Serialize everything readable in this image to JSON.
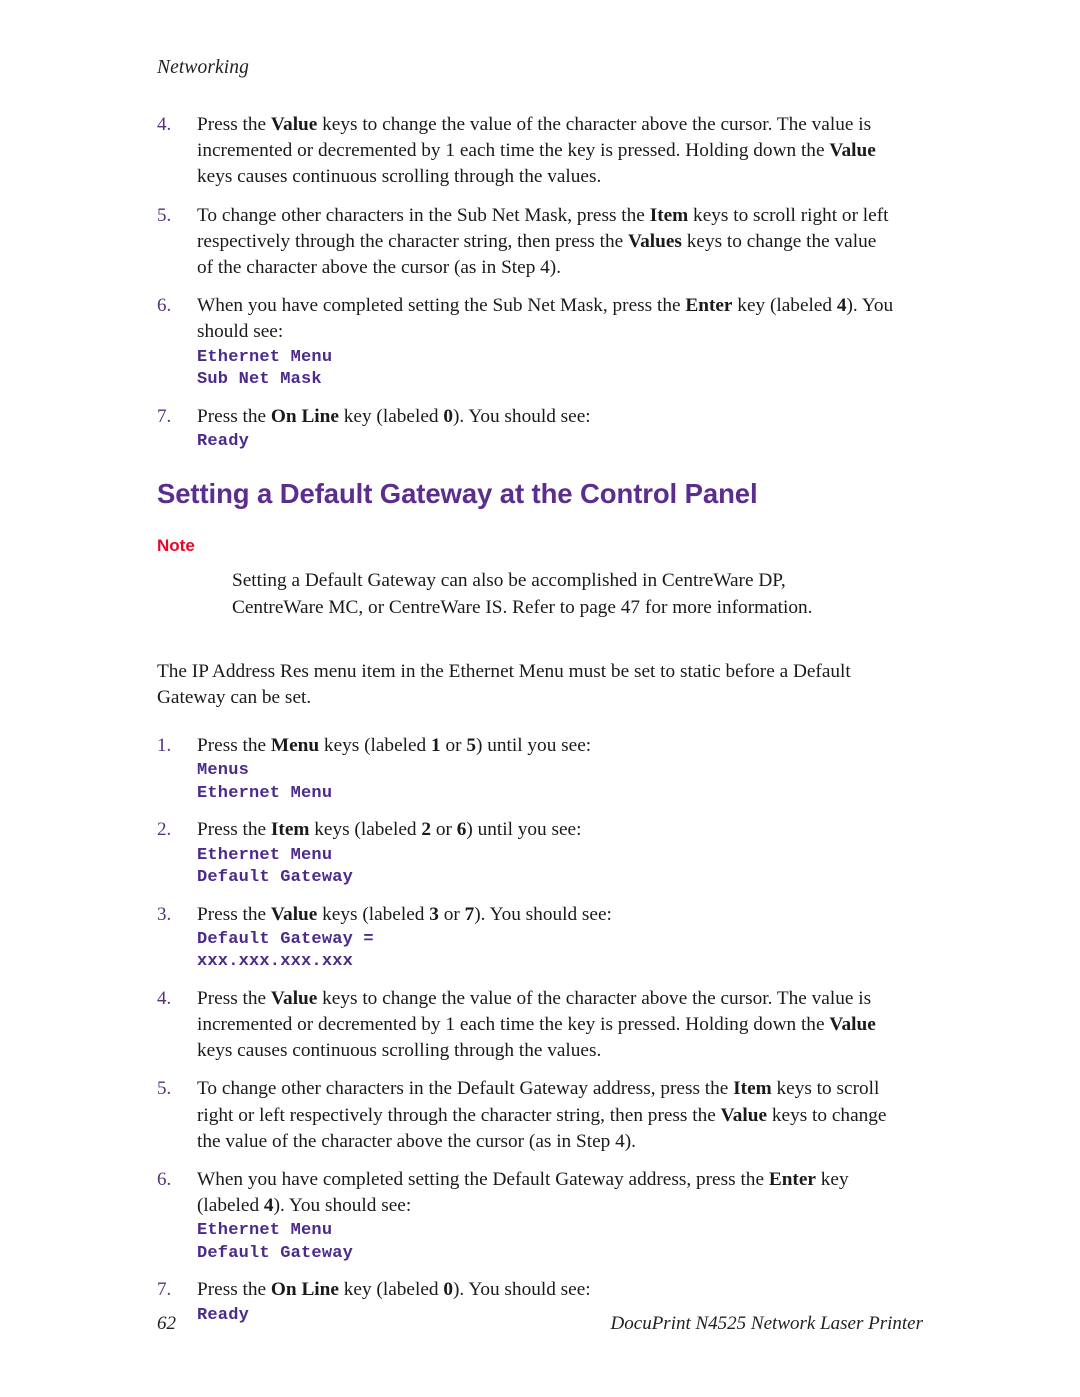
{
  "page": {
    "running_head": "Networking",
    "footer_page_number": "62",
    "footer_title": "DocuPrint N4525 Network Laser Printer"
  },
  "colors": {
    "heading_purple": "#5b2d8e",
    "code_purple": "#4c2a8a",
    "step_number_purple": "#54327d",
    "note_red": "#e3092a",
    "body_black": "#1a1a1a"
  },
  "section_one": {
    "steps": [
      {
        "number": "4.",
        "text_runs": [
          {
            "t": "Press the ",
            "b": false
          },
          {
            "t": "Value",
            "b": true
          },
          {
            "t": " keys to change the value of the character above the cursor. The value is incremented or decremented by 1 each time the key is pressed. Holding down the ",
            "b": false
          },
          {
            "t": "Value",
            "b": true
          },
          {
            "t": " keys causes continuous scrolling through the values.",
            "b": false
          }
        ],
        "code": []
      },
      {
        "number": "5.",
        "text_runs": [
          {
            "t": "To change other characters in the Sub Net Mask, press the ",
            "b": false
          },
          {
            "t": "Item",
            "b": true
          },
          {
            "t": " keys to scroll right or left respectively through the character string, then press the ",
            "b": false
          },
          {
            "t": "Values",
            "b": true
          },
          {
            "t": " keys to change the value of the character above the cursor (as in Step 4).",
            "b": false
          }
        ],
        "code": []
      },
      {
        "number": "6.",
        "text_runs": [
          {
            "t": "When you have completed setting the Sub Net Mask, press the ",
            "b": false
          },
          {
            "t": "Enter",
            "b": true
          },
          {
            "t": " key (labeled ",
            "b": false
          },
          {
            "t": "4",
            "b": true
          },
          {
            "t": "). You should see:",
            "b": false
          }
        ],
        "code": [
          "Ethernet Menu",
          "Sub Net Mask"
        ]
      },
      {
        "number": "7.",
        "text_runs": [
          {
            "t": "Press the ",
            "b": false
          },
          {
            "t": "On Line",
            "b": true
          },
          {
            "t": " key (labeled ",
            "b": false
          },
          {
            "t": "0",
            "b": true
          },
          {
            "t": "). You should see:",
            "b": false
          }
        ],
        "code": [
          "Ready"
        ]
      }
    ]
  },
  "heading": "Setting a Default Gateway at the Control Panel",
  "note": {
    "label": "Note",
    "body": "Setting a Default Gateway can also be accomplished in CentreWare DP, CentreWare MC, or CentreWare IS. Refer to page 47 for more information."
  },
  "intro_paragraph": "The IP Address Res menu item in the Ethernet Menu must be set to static before a Default Gateway can be set.",
  "section_two": {
    "steps": [
      {
        "number": "1.",
        "text_runs": [
          {
            "t": "Press the ",
            "b": false
          },
          {
            "t": "Menu",
            "b": true
          },
          {
            "t": " keys (labeled ",
            "b": false
          },
          {
            "t": "1",
            "b": true
          },
          {
            "t": " or ",
            "b": false
          },
          {
            "t": "5",
            "b": true
          },
          {
            "t": ") until you see:",
            "b": false
          }
        ],
        "code": [
          "Menus",
          "Ethernet Menu"
        ]
      },
      {
        "number": "2.",
        "text_runs": [
          {
            "t": "Press the ",
            "b": false
          },
          {
            "t": "Item",
            "b": true
          },
          {
            "t": " keys (labeled ",
            "b": false
          },
          {
            "t": "2",
            "b": true
          },
          {
            "t": " or ",
            "b": false
          },
          {
            "t": "6",
            "b": true
          },
          {
            "t": ") until you see:",
            "b": false
          }
        ],
        "code": [
          "Ethernet Menu",
          "Default Gateway"
        ]
      },
      {
        "number": "3.",
        "text_runs": [
          {
            "t": "Press the ",
            "b": false
          },
          {
            "t": "Value",
            "b": true
          },
          {
            "t": " keys (labeled ",
            "b": false
          },
          {
            "t": "3",
            "b": true
          },
          {
            "t": " or ",
            "b": false
          },
          {
            "t": "7",
            "b": true
          },
          {
            "t": "). You should see:",
            "b": false
          }
        ],
        "code": [
          "Default Gateway =",
          "xxx.xxx.xxx.xxx"
        ]
      },
      {
        "number": "4.",
        "text_runs": [
          {
            "t": "Press the ",
            "b": false
          },
          {
            "t": "Value",
            "b": true
          },
          {
            "t": " keys to change the value of the character above the cursor. The value is incremented or decremented by 1 each time the key is pressed. Holding down the ",
            "b": false
          },
          {
            "t": "Value",
            "b": true
          },
          {
            "t": " keys causes continuous scrolling through the values.",
            "b": false
          }
        ],
        "code": []
      },
      {
        "number": "5.",
        "text_runs": [
          {
            "t": "To change other characters in the Default Gateway address, press the ",
            "b": false
          },
          {
            "t": "Item",
            "b": true
          },
          {
            "t": " keys to scroll right or left respectively through the character string, then press the ",
            "b": false
          },
          {
            "t": "Value",
            "b": true
          },
          {
            "t": " keys to change the value of the character above the cursor (as in Step 4).",
            "b": false
          }
        ],
        "code": []
      },
      {
        "number": "6.",
        "text_runs": [
          {
            "t": "When you have completed setting the Default Gateway address, press the ",
            "b": false
          },
          {
            "t": "Enter",
            "b": true
          },
          {
            "t": " key (labeled ",
            "b": false
          },
          {
            "t": "4",
            "b": true
          },
          {
            "t": "). You should see:",
            "b": false
          }
        ],
        "code": [
          "Ethernet Menu",
          "Default Gateway"
        ]
      },
      {
        "number": "7.",
        "text_runs": [
          {
            "t": "Press the ",
            "b": false
          },
          {
            "t": "On Line",
            "b": true
          },
          {
            "t": " key (labeled ",
            "b": false
          },
          {
            "t": "0",
            "b": true
          },
          {
            "t": "). You should see:",
            "b": false
          }
        ],
        "code": [
          "Ready"
        ]
      }
    ]
  }
}
